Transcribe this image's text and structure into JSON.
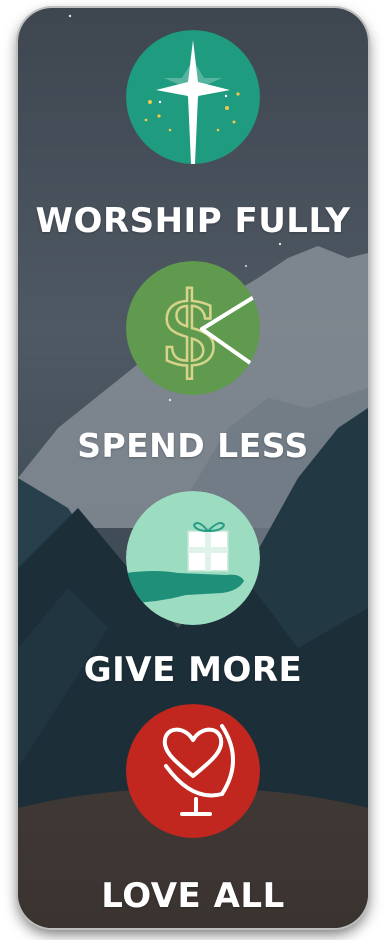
{
  "items": [
    {
      "label": "WORSHIP FULLY",
      "icon": "star-icon",
      "color": "#1f9b7f"
    },
    {
      "label": "SPEND LESS",
      "icon": "dollar-icon",
      "color": "#5f9a4e"
    },
    {
      "label": "GIVE MORE",
      "icon": "gift-hand-icon",
      "color": "#9cdcc0"
    },
    {
      "label": "LOVE ALL",
      "icon": "heart-globe-icon",
      "color": "#c1271f"
    }
  ]
}
